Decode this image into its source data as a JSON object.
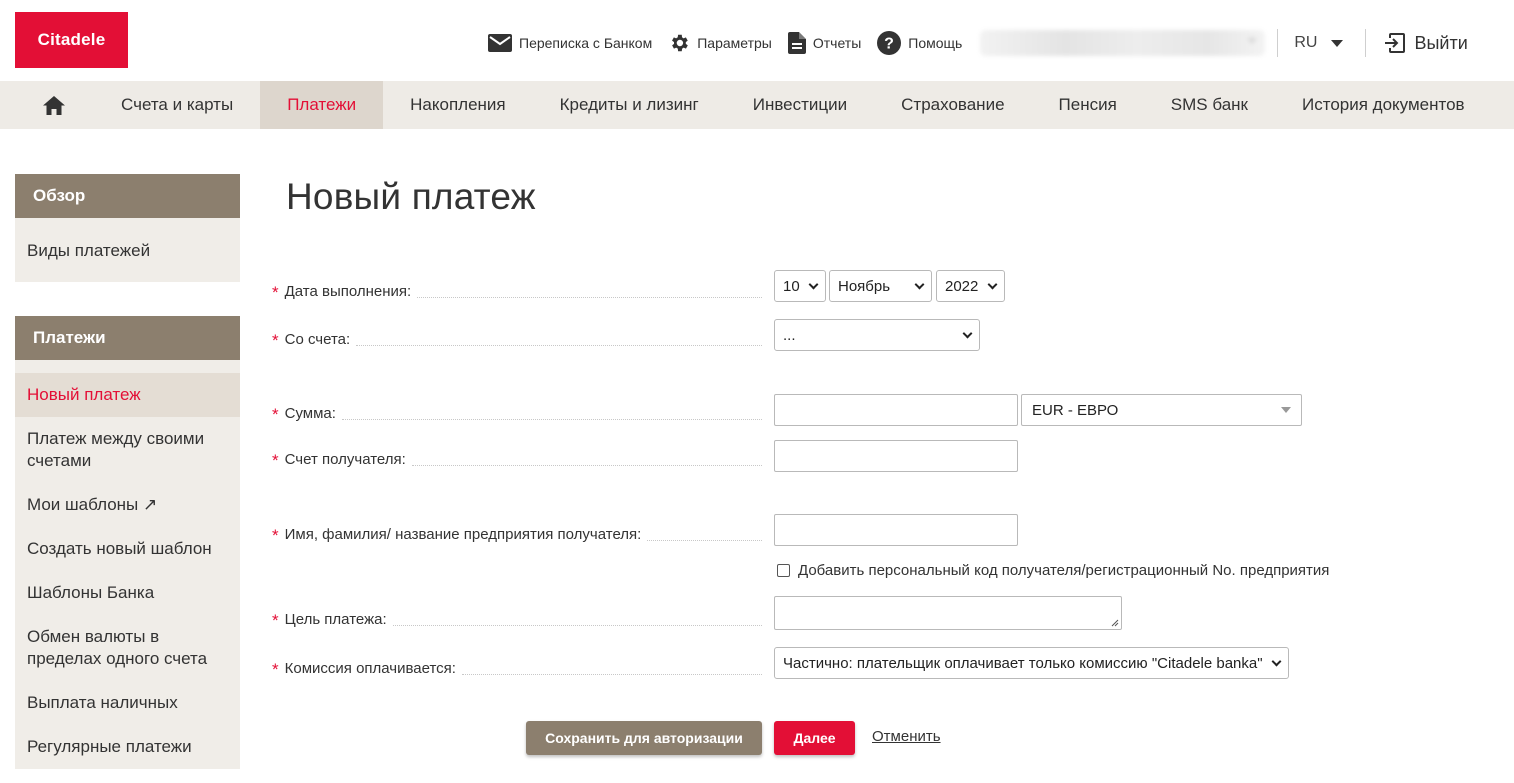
{
  "header": {
    "logo_text": "Citadele",
    "links": [
      {
        "label": "Переписка с Банком",
        "icon": "mail-icon"
      },
      {
        "label": "Параметры",
        "icon": "gear-icon"
      },
      {
        "label": "Отчеты",
        "icon": "document-icon"
      },
      {
        "label": "Помощь",
        "icon": "help-icon"
      }
    ],
    "language": "RU",
    "logout_label": "Выйти"
  },
  "nav": {
    "home_icon": "home-icon",
    "items": [
      "Счета и карты",
      "Платежи",
      "Накопления",
      "Кредиты и лизинг",
      "Инвестиции",
      "Страхование",
      "Пенсия",
      "SMS банк",
      "История документов"
    ],
    "active": "Платежи"
  },
  "sidebar": {
    "overview": {
      "title": "Обзор",
      "items": [
        "Виды платежей"
      ]
    },
    "payments": {
      "title": "Платежи",
      "items": [
        "Новый платеж",
        "Платеж между своими счетами",
        "Мои шаблоны ↗",
        "Создать новый шаблон",
        "Шаблоны Банка",
        "Обмен валюты в пределах одного счета",
        "Выплата наличных",
        "Регулярные платежи"
      ],
      "active": "Новый платеж"
    }
  },
  "page": {
    "title": "Новый платеж"
  },
  "form": {
    "required_mark": "*",
    "date": {
      "label": "Дата выполнения:",
      "day": "10",
      "month": "Ноябрь",
      "year": "2022"
    },
    "from_account": {
      "label": "Со счета:",
      "value": "..."
    },
    "amount": {
      "label": "Сумма:",
      "value": "",
      "currency": "EUR - ЕВРО"
    },
    "beneficiary_account": {
      "label": "Счет получателя:",
      "value": ""
    },
    "beneficiary_name": {
      "label": "Имя, фамилия/ название предприятия получателя:",
      "value": ""
    },
    "add_code_checkbox": {
      "label": "Добавить персональный код получателя/регистрационный No. предприятия",
      "checked": false
    },
    "purpose": {
      "label": "Цель платежа:",
      "value": ""
    },
    "commission": {
      "label": "Комиссия оплачивается:",
      "value": "Частично: плательщик оплачивает только комиссию \"Citadele banka\""
    }
  },
  "actions": {
    "save_label": "Сохранить для авторизации",
    "next_label": "Далее",
    "cancel_label": "Отменить"
  },
  "colors": {
    "brand_red": "#e30f36",
    "sidebar_head": "#8c7f6e",
    "nav_bg": "#eeebe6"
  }
}
